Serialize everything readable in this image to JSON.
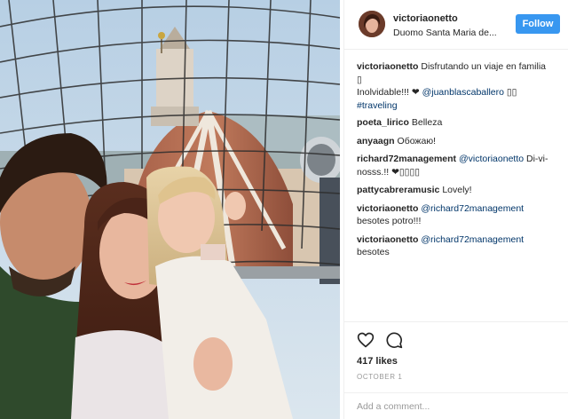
{
  "header": {
    "username": "victoriaonetto",
    "location": "Duomo Santa Maria de...",
    "follow_label": "Follow"
  },
  "caption": {
    "username": "victoriaonetto",
    "text_1": "Disfrutando un viaje en familia",
    "box_1": "▯",
    "text_2": "Inolvidable!!! ❤",
    "mention": "@juanblascaballero",
    "box_2": "▯▯",
    "hashtag": "#traveling"
  },
  "comments": [
    {
      "username": "poeta_lirico",
      "text": "Belleza"
    },
    {
      "username": "anyaagn",
      "text": "Обожаю!"
    },
    {
      "username": "richard72management",
      "mention": "@victoriaonetto",
      "text": "Di-vi-nosss.!! ❤▯▯▯▯"
    },
    {
      "username": "pattycabreramusic",
      "text": "Lovely!"
    },
    {
      "username": "victoriaonetto",
      "mention": "@richard72management",
      "text": "besotes potro!!!"
    },
    {
      "username": "victoriaonetto",
      "mention": "@richard72management",
      "text": "besotes"
    }
  ],
  "actions": {
    "likes": "417 likes",
    "date": "OCTOBER 1",
    "like_icon": "heart-outline-icon",
    "comment_icon": "speech-bubble-icon"
  },
  "add_comment": {
    "placeholder": "Add a comment..."
  },
  "colors": {
    "follow_blue": "#3897f0",
    "link_navy": "#003569",
    "meta_gray": "#999999",
    "border": "#efefef"
  }
}
